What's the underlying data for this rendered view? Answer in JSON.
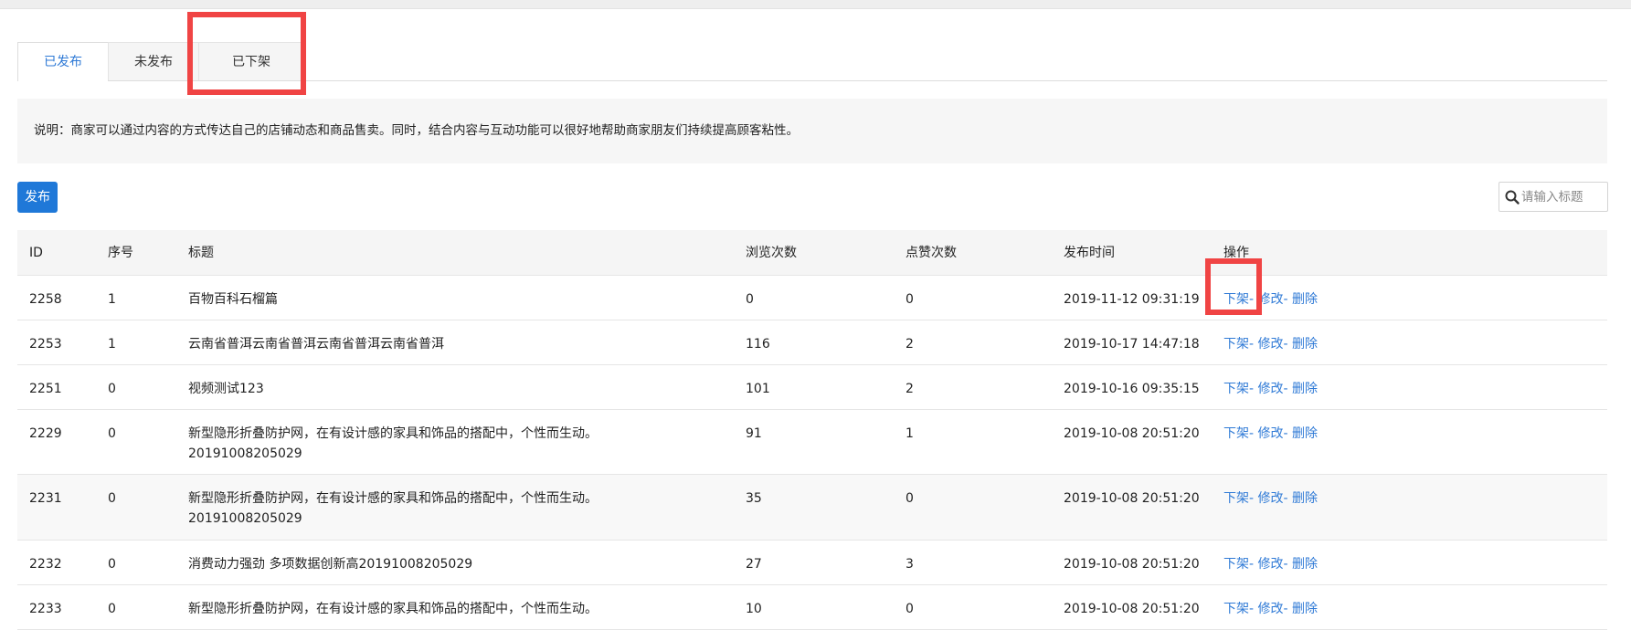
{
  "tabs": [
    {
      "label": "已发布",
      "active": true
    },
    {
      "label": "未发布",
      "active": false
    },
    {
      "label": "已下架",
      "active": false
    }
  ],
  "notice": "说明：商家可以通过内容的方式传达自己的店铺动态和商品售卖。同时，结合内容与互动功能可以很好地帮助商家朋友们持续提高顾客粘性。",
  "toolbar": {
    "publish_label": "发布",
    "search_placeholder": "请输入标题"
  },
  "table": {
    "headers": {
      "id": "ID",
      "seq": "序号",
      "title": "标题",
      "views": "浏览次数",
      "likes": "点赞次数",
      "time": "发布时间",
      "ops": "操作"
    },
    "actions": {
      "takedown": "下架",
      "edit": "修改",
      "delete": "删除",
      "sep": "-"
    },
    "rows": [
      {
        "id": "2258",
        "seq": "1",
        "title": "百物百科石榴篇",
        "views": "0",
        "likes": "0",
        "time": "2019-11-12 09:31:19"
      },
      {
        "id": "2253",
        "seq": "1",
        "title": "云南省普洱云南省普洱云南省普洱云南省普洱",
        "views": "116",
        "likes": "2",
        "time": "2019-10-17 14:47:18"
      },
      {
        "id": "2251",
        "seq": "0",
        "title": "视频测试123",
        "views": "101",
        "likes": "2",
        "time": "2019-10-16 09:35:15"
      },
      {
        "id": "2229",
        "seq": "0",
        "title": "新型隐形折叠防护网，在有设计感的家具和饰品的搭配中，个性而生动。20191008205029",
        "views": "91",
        "likes": "1",
        "time": "2019-10-08 20:51:20"
      },
      {
        "id": "2231",
        "seq": "0",
        "title": "新型隐形折叠防护网，在有设计感的家具和饰品的搭配中，个性而生动。20191008205029",
        "views": "35",
        "likes": "0",
        "time": "2019-10-08 20:51:20"
      },
      {
        "id": "2232",
        "seq": "0",
        "title": "消费动力强劲 多项数据创新高20191008205029",
        "views": "27",
        "likes": "3",
        "time": "2019-10-08 20:51:20"
      },
      {
        "id": "2233",
        "seq": "0",
        "title": "新型隐形折叠防护网，在有设计感的家具和饰品的搭配中，个性而生动。",
        "views": "10",
        "likes": "0",
        "time": "2019-10-08 20:51:20"
      }
    ]
  },
  "colors": {
    "accent": "#2f7ad6",
    "primary_button": "#1f78d8",
    "highlight": "#f04444"
  }
}
